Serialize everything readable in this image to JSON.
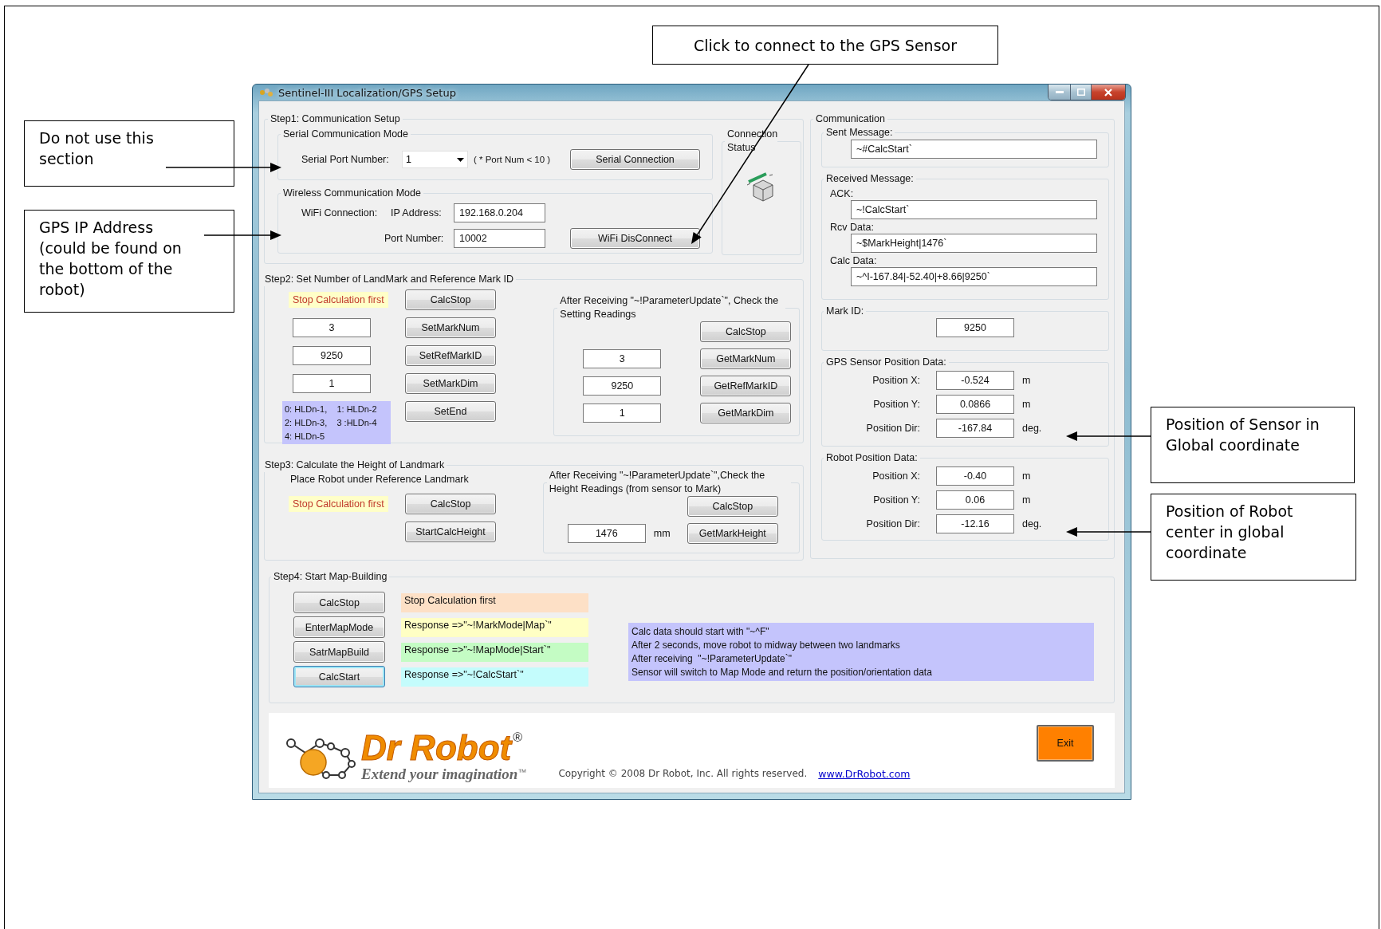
{
  "callouts": [
    {
      "text": "Click to connect to the GPS Sensor"
    },
    {
      "text": "Do not use this\nsection"
    },
    {
      "text": "GPS IP Address\n(could be found on\nthe bottom of the\nrobot)"
    },
    {
      "text": "Position of Sensor in\nGlobal coordinate"
    },
    {
      "text": "Position of Robot\ncenter in global\ncoordinate"
    }
  ],
  "window": {
    "title": "Sentinel-III Localization/GPS Setup"
  },
  "step1": {
    "title": "Step1: Communication Setup",
    "serial": {
      "title": "Serial Communication Mode",
      "port_label": "Serial Port Number:",
      "port_value": "1",
      "hint": "( * Port Num < 10 )",
      "button": "Serial Connection"
    },
    "wireless": {
      "title": "Wireless Communication Mode",
      "wifi_label": "WiFi Connection:",
      "ip_label": "IP Address:",
      "ip_value": "192.168.0.204",
      "port_label": "Port Number:",
      "port_value": "10002",
      "button": "WiFi DisConnect"
    },
    "status": {
      "title": "Connection Status"
    }
  },
  "step2": {
    "title": "Step2: Set Number of LandMark and Reference Mark ID",
    "note": "Stop Calculation first",
    "buttons": [
      "CalcStop",
      "SetMarkNum",
      "SetRefMarkID",
      "SetMarkDim",
      "SetEnd"
    ],
    "values": [
      "3",
      "9250",
      "1"
    ],
    "legend": [
      "0: HLDn-1,    1: HLDn-2",
      "2: HLDn-3,    3 :HLDn-4",
      "4: HLDn-5"
    ],
    "check": {
      "title": "After Receiving \"~!ParameterUpdate`\", Check the Setting Readings",
      "buttons": [
        "CalcStop",
        "GetMarkNum",
        "GetRefMarkID",
        "GetMarkDim"
      ],
      "values": [
        "3",
        "9250",
        "1"
      ]
    }
  },
  "step3": {
    "title": "Step3: Calculate the Height of Landmark",
    "instruction": "Place Robot under Reference Landmark",
    "note": "Stop Calculation first",
    "buttons": [
      "CalcStop",
      "StartCalcHeight"
    ],
    "check": {
      "title": "After Receiving \"~!ParameterUpdate`\",Check the Height Readings (from sensor to Mark)",
      "value": "1476",
      "unit": "mm",
      "buttons": [
        "CalcStop",
        "GetMarkHeight"
      ]
    }
  },
  "step4": {
    "title": "Step4: Start Map-Building",
    "rows": [
      {
        "button": "CalcStop",
        "response": "Stop Calculation first",
        "color": "#fde0c6",
        "focused": false
      },
      {
        "button": "EnterMapMode",
        "response": "Response =>\"~!MarkMode|Map`\"",
        "color": "#ffffc4",
        "focused": false
      },
      {
        "button": "SatrMapBuild",
        "response": "Response =>\"~!MapMode|Start`\"",
        "color": "#c4fcc4",
        "focused": false
      },
      {
        "button": "CalcStart",
        "response": "Response =>\"~!CalcStart`\"",
        "color": "#c4fcfc",
        "focused": true
      }
    ],
    "notes": [
      "Calc data should start with \"~^F\"",
      "After 2 seconds, move robot to midway between two landmarks",
      "After receiving  \"~!ParameterUpdate`\"",
      "Sensor will switch to Map Mode and return the position/orientation data"
    ]
  },
  "communication": {
    "title": "Communication",
    "sent": {
      "title": "Sent Message:",
      "value": "~#CalcStart`"
    },
    "received": {
      "title": "Received Message:",
      "fields": [
        {
          "label": "ACK:",
          "value": "~!CalcStart`"
        },
        {
          "label": "Rcv Data:",
          "value": "~$MarkHeight|1476`"
        },
        {
          "label": "Calc Data:",
          "value": "~^I-167.84|-52.40|+8.66|9250`"
        }
      ]
    },
    "mark": {
      "title": "Mark ID:",
      "value": "9250"
    },
    "sensor": {
      "title": "GPS Sensor Position Data:",
      "rows": [
        {
          "label": "Position X:",
          "value": "-0.524",
          "unit": "m"
        },
        {
          "label": "Position Y:",
          "value": "0.0866",
          "unit": "m"
        },
        {
          "label": "Position Dir:",
          "value": "-167.84",
          "unit": "deg."
        }
      ]
    },
    "robot": {
      "title": "Robot Position Data:",
      "rows": [
        {
          "label": "Position X:",
          "value": "-0.40",
          "unit": "m"
        },
        {
          "label": "Position Y:",
          "value": "0.06",
          "unit": "m"
        },
        {
          "label": "Position Dir:",
          "value": "-12.16",
          "unit": "deg."
        }
      ]
    }
  },
  "footer": {
    "logo": "Dr Robot",
    "registered": "®",
    "tagline": "Extend your imagination",
    "trademark": "™",
    "copyright": "Copyright © 2008 Dr Robot, Inc. All rights reserved.",
    "link": "www.DrRobot.com",
    "exit": "Exit"
  }
}
